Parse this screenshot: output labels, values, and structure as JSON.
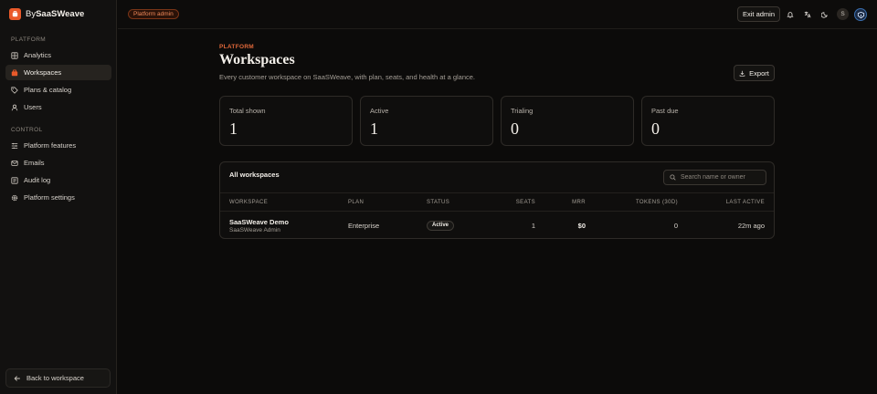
{
  "brand": {
    "prefix": "By",
    "name": "SaaSWeave"
  },
  "sidebar": {
    "sections": [
      {
        "label": "PLATFORM"
      },
      {
        "label": "CONTROL"
      }
    ],
    "items": [
      {
        "label": "Analytics",
        "icon": "grid-icon"
      },
      {
        "label": "Workspaces",
        "icon": "briefcase-icon",
        "active": true
      },
      {
        "label": "Plans & catalog",
        "icon": "tag-icon"
      },
      {
        "label": "Users",
        "icon": "user-icon"
      },
      {
        "label": "Platform features",
        "icon": "list-icon"
      },
      {
        "label": "Emails",
        "icon": "mail-icon"
      },
      {
        "label": "Audit log",
        "icon": "log-icon"
      },
      {
        "label": "Platform settings",
        "icon": "gear-icon"
      }
    ],
    "back_label": "Back to workspace"
  },
  "topbar": {
    "badge": "Platform admin",
    "exit_label": "Exit admin",
    "avatar_initial": "S"
  },
  "page": {
    "eyebrow": "PLATFORM",
    "title": "Workspaces",
    "subtitle": "Every customer workspace on SaaSWeave, with plan, seats, and health at a glance.",
    "export_label": "Export"
  },
  "stats": [
    {
      "label": "Total shown",
      "value": "1"
    },
    {
      "label": "Active",
      "value": "1"
    },
    {
      "label": "Trialing",
      "value": "0"
    },
    {
      "label": "Past due",
      "value": "0"
    }
  ],
  "table": {
    "title": "All workspaces",
    "search_placeholder": "Search name or owner",
    "headers": {
      "workspace": "WORKSPACE",
      "plan": "PLAN",
      "status": "STATUS",
      "seats": "SEATS",
      "mrr": "MRR",
      "tokens": "TOKENS (30D)",
      "last_active": "LAST ACTIVE"
    },
    "rows": [
      {
        "name": "SaaSWeave Demo",
        "owner": "SaaSWeave Admin",
        "plan": "Enterprise",
        "status": "Active",
        "seats": "1",
        "mrr": "$0",
        "tokens": "0",
        "last_active": "22m ago"
      }
    ]
  },
  "colors": {
    "accent": "#ea5a2a",
    "background": "#0c0b0a",
    "sidebar": "#121110"
  }
}
